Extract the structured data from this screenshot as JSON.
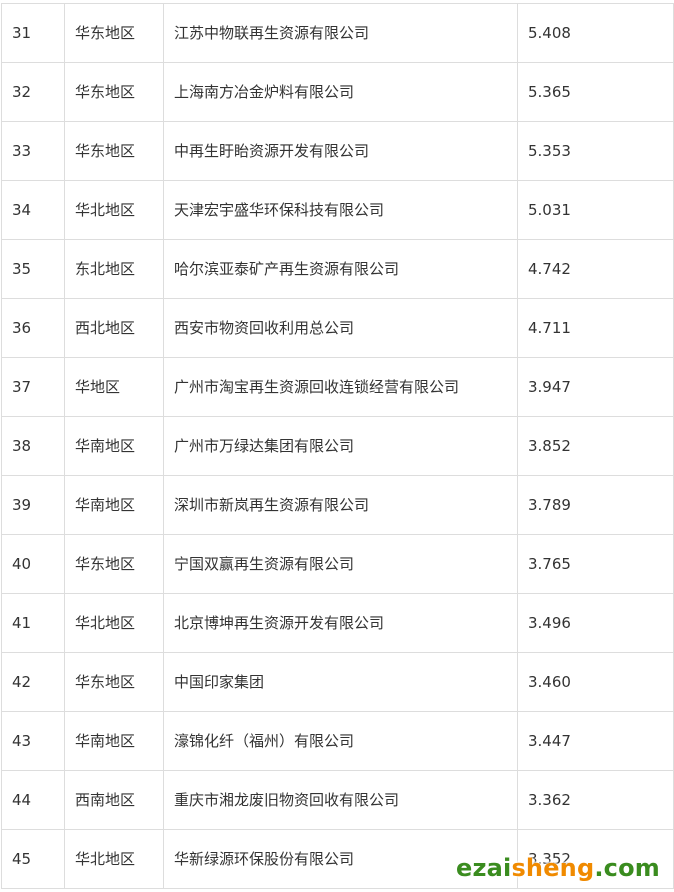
{
  "table": {
    "rows": [
      {
        "rank": "31",
        "region": "华东地区",
        "company": "江苏中物联再生资源有限公司",
        "value": "5.408"
      },
      {
        "rank": "32",
        "region": "华东地区",
        "company": "上海南方冶金炉料有限公司",
        "value": "5.365"
      },
      {
        "rank": "33",
        "region": "华东地区",
        "company": "中再生盱眙资源开发有限公司",
        "value": "5.353"
      },
      {
        "rank": "34",
        "region": "华北地区",
        "company": "天津宏宇盛华环保科技有限公司",
        "value": "5.031"
      },
      {
        "rank": "35",
        "region": "东北地区",
        "company": "哈尔滨亚泰矿产再生资源有限公司",
        "value": "4.742"
      },
      {
        "rank": "36",
        "region": "西北地区",
        "company": "西安市物资回收利用总公司",
        "value": "4.711"
      },
      {
        "rank": "37",
        "region": "华地区",
        "company": "广州市淘宝再生资源回收连锁经营有限公司",
        "value": "3.947"
      },
      {
        "rank": "38",
        "region": "华南地区",
        "company": "广州市万绿达集团有限公司",
        "value": "3.852"
      },
      {
        "rank": "39",
        "region": "华南地区",
        "company": "深圳市新岚再生资源有限公司",
        "value": "3.789"
      },
      {
        "rank": "40",
        "region": "华东地区",
        "company": "宁国双赢再生资源有限公司",
        "value": "3.765"
      },
      {
        "rank": "41",
        "region": "华北地区",
        "company": "北京博坤再生资源开发有限公司",
        "value": "3.496"
      },
      {
        "rank": "42",
        "region": "华东地区",
        "company": "中国印家集团",
        "value": "3.460"
      },
      {
        "rank": "43",
        "region": "华南地区",
        "company": "濠锦化纤（福州）有限公司",
        "value": "3.447"
      },
      {
        "rank": "44",
        "region": "西南地区",
        "company": "重庆市湘龙废旧物资回收有限公司",
        "value": "3.362"
      },
      {
        "rank": "45",
        "region": "华北地区",
        "company": "华新绿源环保股份有限公司",
        "value": "3.352"
      }
    ]
  },
  "watermark": {
    "part1": "ezai",
    "part2": "sheng",
    "part3": ".com",
    "colors": {
      "green": "#3a8c1f",
      "orange": "#f08a00"
    }
  }
}
